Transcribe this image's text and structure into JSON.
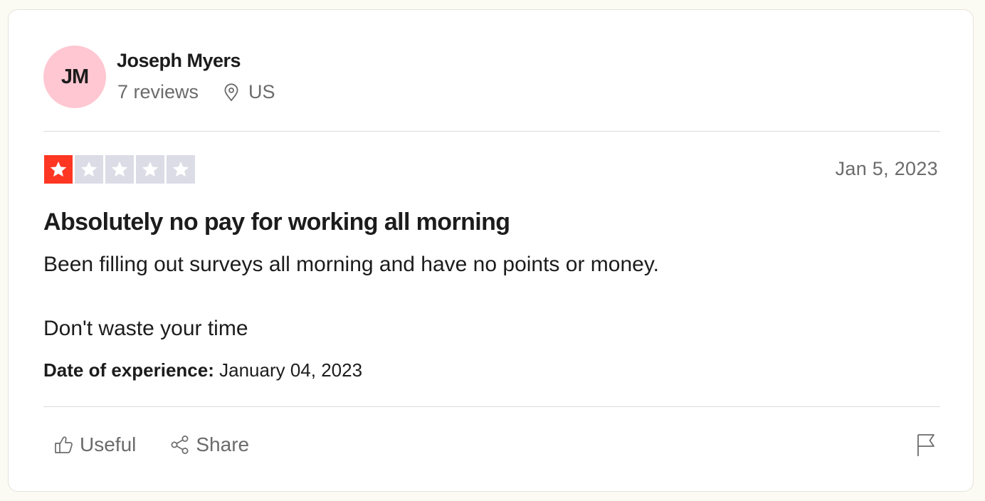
{
  "reviewer": {
    "initials": "JM",
    "name": "Joseph Myers",
    "reviews_count": "7 reviews",
    "country": "US",
    "avatar_color": "#ffc7d2"
  },
  "review": {
    "rating": 1,
    "max_rating": 5,
    "star_filled_color": "#ff3722",
    "star_empty_color": "#dcdce6",
    "date": "Jan 5, 2023",
    "title": "Absolutely no pay for working all morning",
    "body_line_1": "Been filling out surveys all morning and have no points or money.",
    "body_line_2": "Don't waste your time",
    "experience_label": "Date of experience:",
    "experience_date": "January 04, 2023"
  },
  "actions": {
    "useful_label": "Useful",
    "share_label": "Share",
    "icons": [
      "thumbs-up-icon",
      "share-icon",
      "flag-icon"
    ]
  }
}
